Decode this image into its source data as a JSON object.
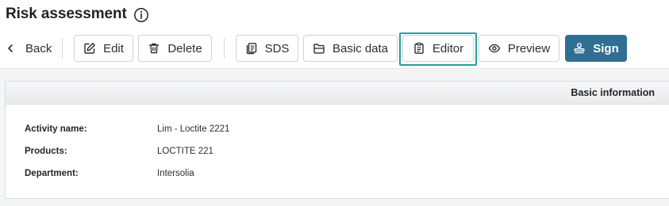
{
  "page": {
    "title": "Risk assessment",
    "title_icon": "info-circle-icon"
  },
  "toolbar": {
    "back_label": "Back",
    "back_icon": "chevron-left-icon",
    "buttons": [
      {
        "label": "Edit",
        "icon": "pencil-square-icon"
      },
      {
        "label": "Delete",
        "icon": "trash-icon"
      },
      {
        "label": "SDS",
        "icon": "documents-icon"
      },
      {
        "label": "Basic data",
        "icon": "folder-icon"
      },
      {
        "label": "Editor",
        "icon": "clipboard-icon"
      },
      {
        "label": "Preview",
        "icon": "eye-icon"
      },
      {
        "label": "Sign",
        "icon": "stamp-icon"
      }
    ],
    "focused_button": "Editor"
  },
  "card": {
    "header_title": "Basic information",
    "rows": [
      {
        "label": "Activity name:",
        "value": "Lim - Loctite 2221"
      },
      {
        "label": "Products:",
        "value": "LOCTITE 221"
      },
      {
        "label": "Department:",
        "value": "Intersolia"
      }
    ]
  },
  "colors": {
    "primary": "#2f6f93",
    "focus_ring": "#2aa198",
    "border": "#cfd3d8",
    "content_bg": "#f4f5f6"
  }
}
